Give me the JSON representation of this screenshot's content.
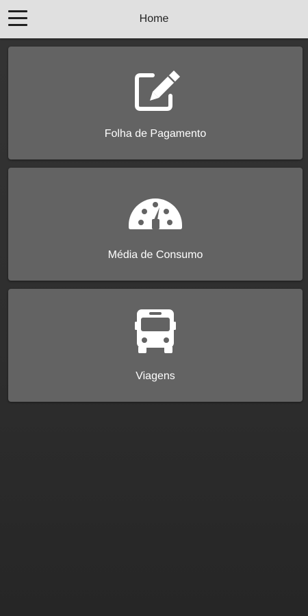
{
  "app_bar": {
    "title": "Home",
    "menu_icon": "hamburger-menu-icon"
  },
  "menu_cards": [
    {
      "label": "Folha de Pagamento",
      "icon": "edit-pencil-icon"
    },
    {
      "label": "Média de Consumo",
      "icon": "speedometer-icon"
    },
    {
      "label": "Viagens",
      "icon": "bus-icon"
    }
  ],
  "colors": {
    "app_bar_background": "#e0e0e0",
    "card_background": "#636363",
    "page_background": "#2f2f2f",
    "text_light": "#ffffff",
    "text_dark": "#222222"
  }
}
